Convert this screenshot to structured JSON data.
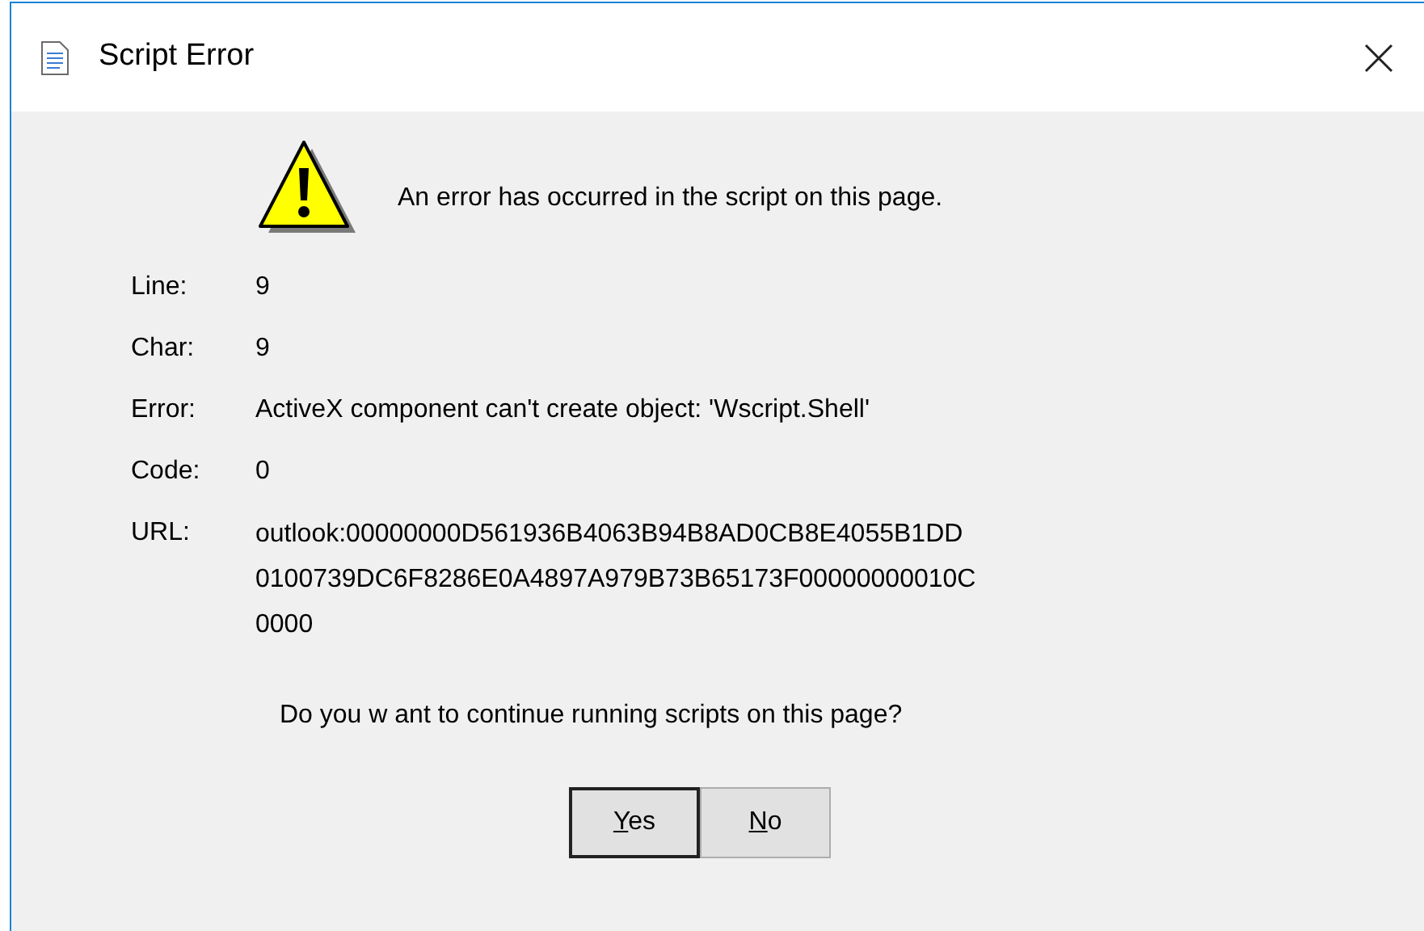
{
  "window": {
    "title": "Script Error"
  },
  "message": "An error has occurred in the script on this page.",
  "details": [
    {
      "label": "Line:",
      "value": "9"
    },
    {
      "label": "Char:",
      "value": "9"
    },
    {
      "label": "Error:",
      "value": "ActiveX component can't create object: 'Wscript.Shell'"
    },
    {
      "label": "Code:",
      "value": "0"
    },
    {
      "label": "URL:",
      "value_lines": [
        "outlook:00000000D561936B4063B94B8AD0CB8E4055B1DD",
        "0100739DC6F8286E0A4897A979B73B65173F00000000010C",
        "0000"
      ]
    }
  ],
  "question": "Do you w ant to continue running scripts on this page?",
  "buttons": [
    {
      "mnemonic": "Y",
      "rest": "es",
      "default": true
    },
    {
      "mnemonic": "N",
      "rest": "o",
      "default": false
    }
  ]
}
